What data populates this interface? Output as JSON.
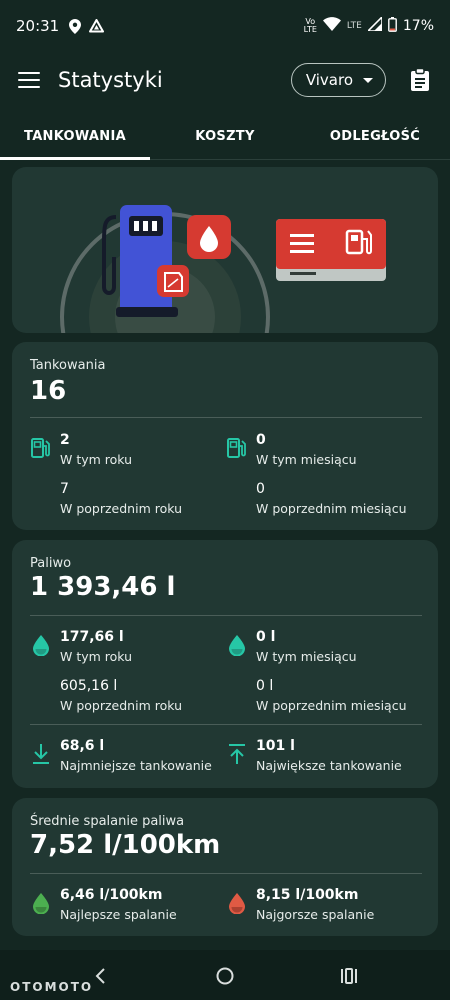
{
  "status_bar": {
    "time": "20:31",
    "volte_top": "Vo",
    "volte_bottom": "LTE",
    "lte": "LTE",
    "battery": "17%"
  },
  "app_bar": {
    "title": "Statystyki",
    "vehicle": "Vivaro"
  },
  "tabs": [
    {
      "label": "TANKOWANIA",
      "active": true
    },
    {
      "label": "KOSZTY",
      "active": false
    },
    {
      "label": "ODLEGŁOŚĆ",
      "active": false
    }
  ],
  "refuels": {
    "label": "Tankowania",
    "total": "16",
    "this_year_value": "2",
    "this_year_label": "W tym roku",
    "this_month_value": "0",
    "this_month_label": "W tym miesiącu",
    "prev_year_value": "7",
    "prev_year_label": "W poprzednim roku",
    "prev_month_value": "0",
    "prev_month_label": "W poprzednim miesiącu"
  },
  "fuel": {
    "label": "Paliwo",
    "total": "1 393,46 l",
    "this_year_value": "177,66 l",
    "this_year_label": "W tym roku",
    "this_month_value": "0 l",
    "this_month_label": "W tym miesiącu",
    "prev_year_value": "605,16 l",
    "prev_year_label": "W poprzednim roku",
    "prev_month_value": "0 l",
    "prev_month_label": "W poprzednim miesiącu",
    "min_value": "68,6 l",
    "min_label": "Najmniejsze tankowanie",
    "max_value": "101 l",
    "max_label": "Największe tankowanie"
  },
  "consumption": {
    "label": "Średnie spalanie paliwa",
    "average": "7,52 l/100km",
    "best_value": "6,46 l/100km",
    "best_label": "Najlepsze spalanie",
    "worst_value": "8,15 l/100km",
    "worst_label": "Najgorsze spalanie"
  },
  "nav": {
    "watermark": "OTOMOTO"
  },
  "colors": {
    "background": "#142722",
    "card": "#213833",
    "accent_teal": "#26c6a6",
    "best_green": "#4caf50",
    "worst_red": "#e05a44",
    "pump_blue": "#4253d6",
    "red_icon": "#d63a31"
  }
}
